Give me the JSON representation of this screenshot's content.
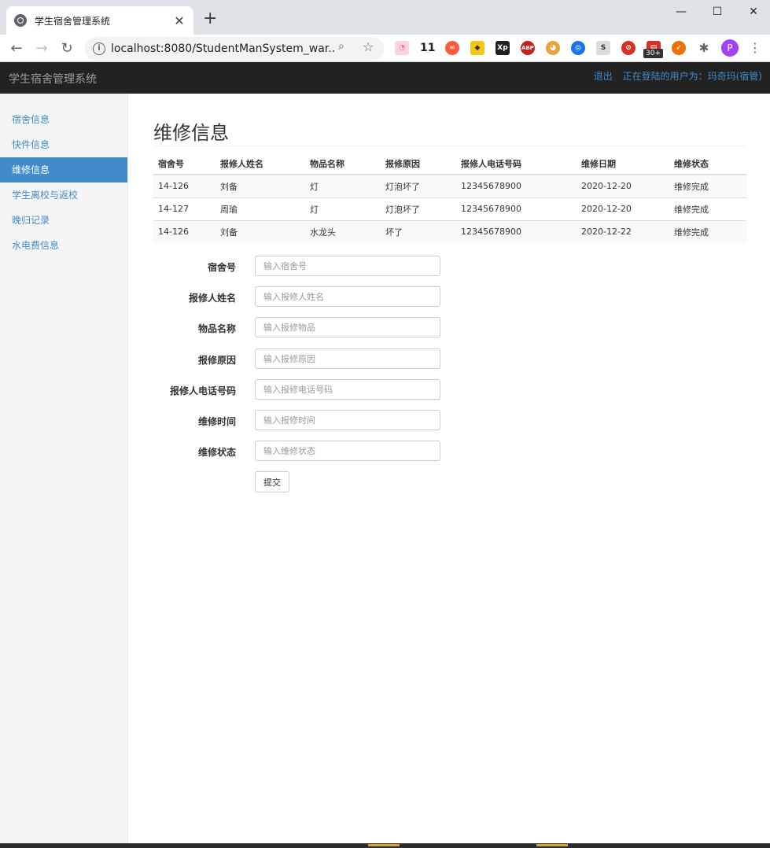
{
  "browser": {
    "tab_title": "学生宿舍管理系统",
    "tab_close": "✕",
    "new_tab": "+",
    "url": "localhost:8080/StudentManSystem_war...",
    "ext_count": "11",
    "ext_badge": "30+",
    "profile_initial": "P",
    "ext_xp": "Xp",
    "ext_abp": "ABP",
    "ext_s": "S"
  },
  "navbar": {
    "brand": "学生宿舍管理系统",
    "logout": "退出",
    "user_info": "正在登陆的用户为：玛奇玛(宿管)"
  },
  "sidebar": {
    "items": [
      {
        "label": "宿舍信息"
      },
      {
        "label": "快件信息"
      },
      {
        "label": "维修信息"
      },
      {
        "label": "学生离校与返校"
      },
      {
        "label": "晚归记录"
      },
      {
        "label": "水电费信息"
      }
    ],
    "active_index": 2
  },
  "main": {
    "title": "维修信息",
    "table": {
      "headers": [
        "宿舍号",
        "报修人姓名",
        "物品名称",
        "报修原因",
        "报修人电话号码",
        "维修日期",
        "维修状态"
      ],
      "rows": [
        [
          "14-126",
          "刘备",
          "灯",
          "灯泡坏了",
          "12345678900",
          "2020-12-20",
          "维修完成"
        ],
        [
          "14-127",
          "周瑜",
          "灯",
          "灯泡坏了",
          "12345678900",
          "2020-12-20",
          "维修完成"
        ],
        [
          "14-126",
          "刘备",
          "水龙头",
          "坏了",
          "12345678900",
          "2020-12-22",
          "维修完成"
        ]
      ]
    },
    "form": {
      "fields": [
        {
          "label": "宿舍号",
          "placeholder": "输入宿舍号",
          "value": ""
        },
        {
          "label": "报修人姓名",
          "placeholder": "输入报修人姓名",
          "value": ""
        },
        {
          "label": "物品名称",
          "placeholder": "输入报修物品",
          "value": ""
        },
        {
          "label": "报修原因",
          "placeholder": "输入报修原因",
          "value": ""
        },
        {
          "label": "报修人电话号码",
          "placeholder": "输入报修电话号码",
          "value": ""
        },
        {
          "label": "维修时间",
          "placeholder": "输入报修时间",
          "value": ""
        },
        {
          "label": "维修状态",
          "placeholder": "输入维修状态",
          "value": ""
        }
      ],
      "submit_label": "提交"
    }
  },
  "colors": {
    "navbar_bg": "#222222",
    "accent": "#428bca",
    "sidebar_bg": "#f5f5f5"
  }
}
